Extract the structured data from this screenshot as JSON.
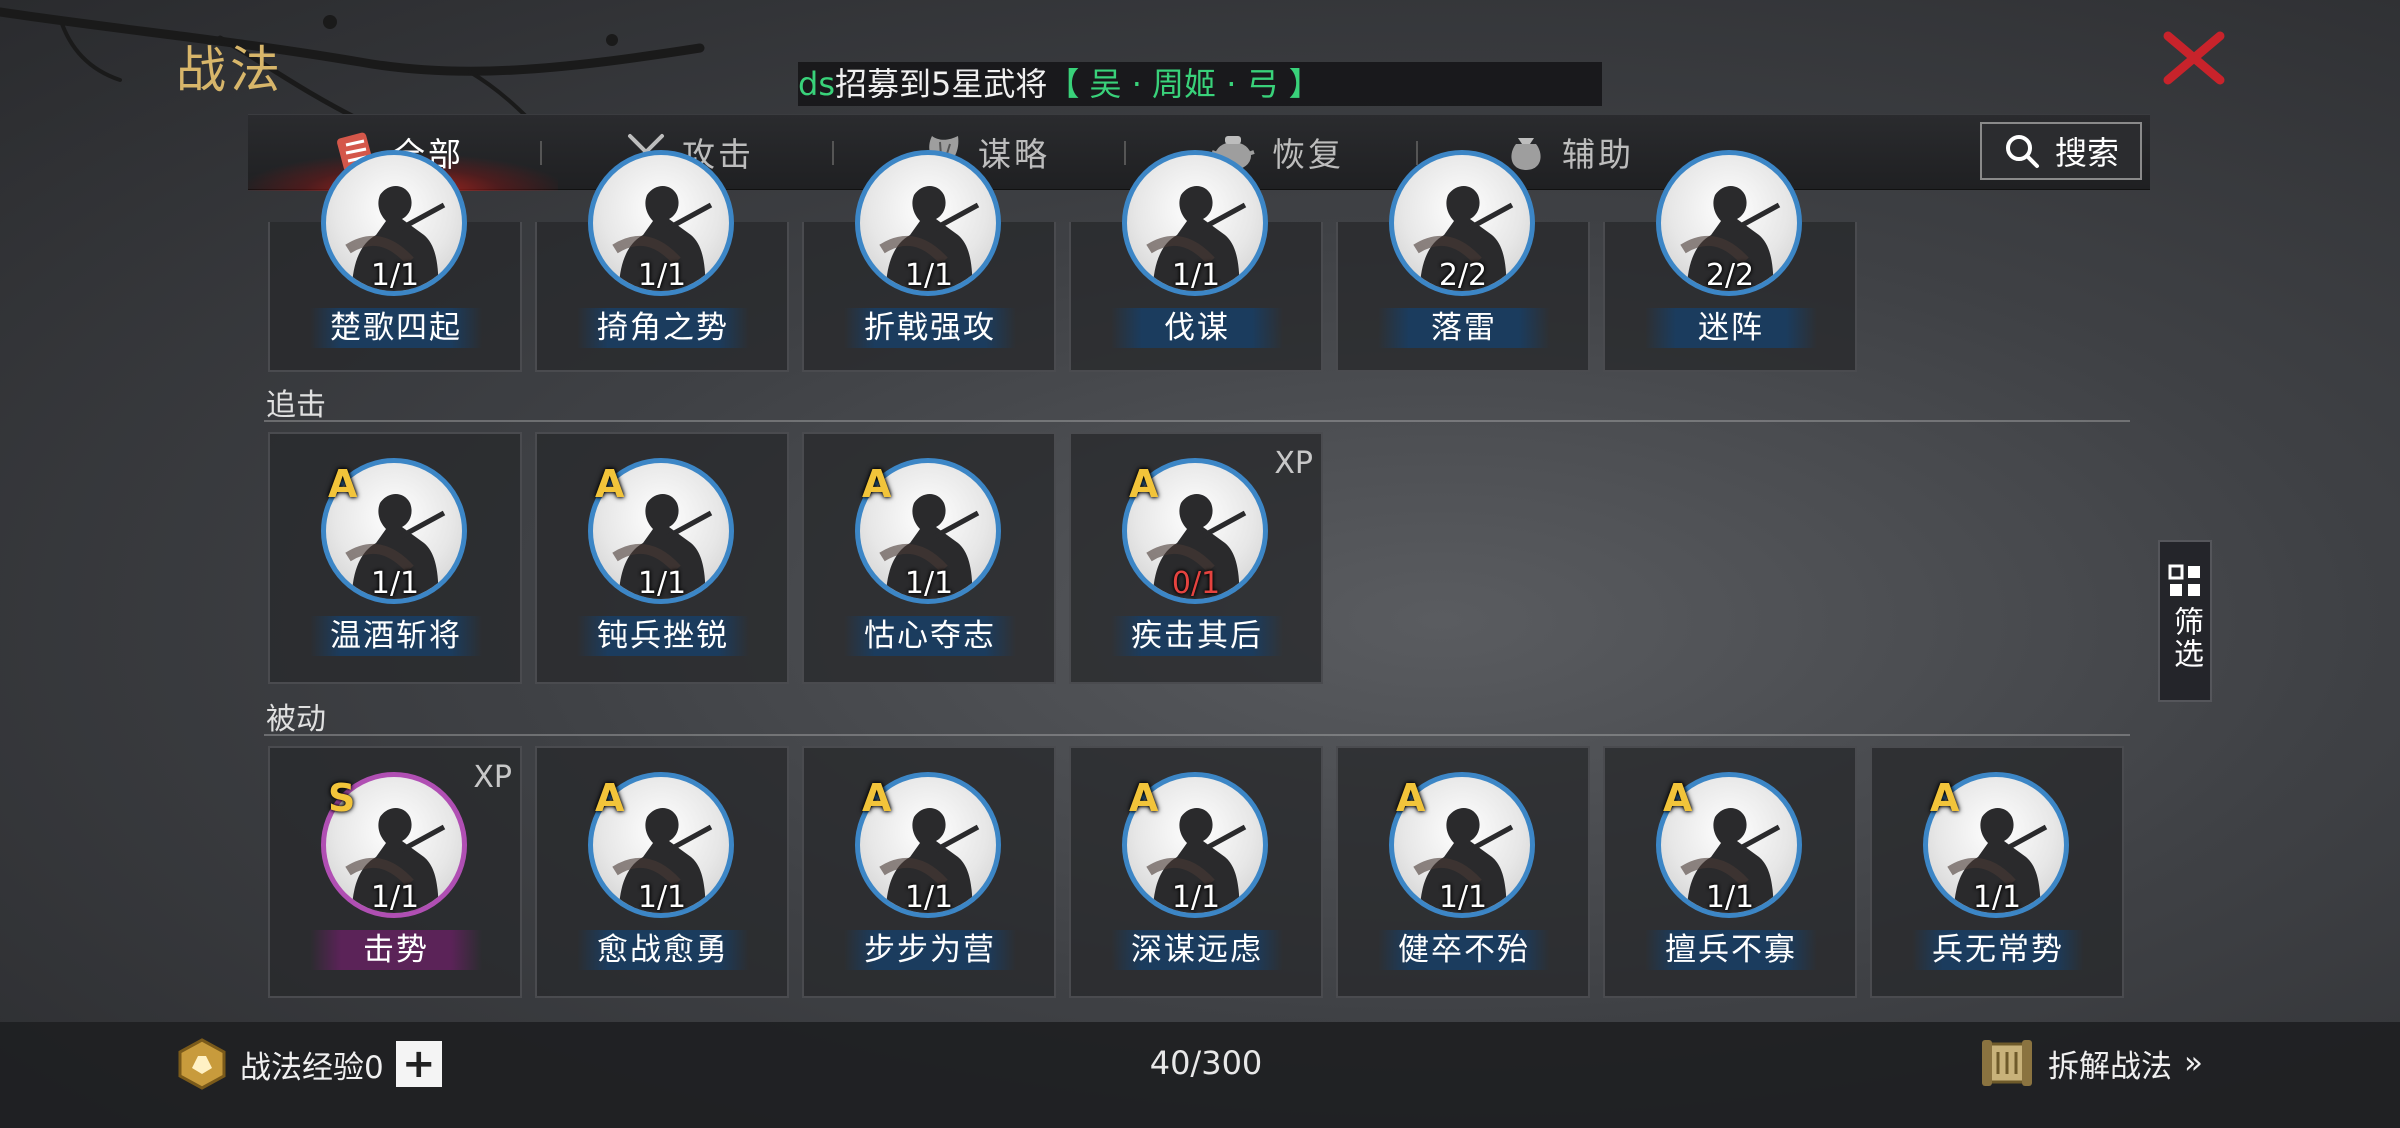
{
  "title": "战法",
  "marquee": {
    "prefix": "ds",
    "text": "招募到5星武将",
    "hero": "【 吴 · 周姬 · 弓 】"
  },
  "tabs": [
    {
      "label": "全部",
      "icon": "all-skills-icon",
      "active": true
    },
    {
      "label": "攻击",
      "icon": "crossed-swords-icon",
      "active": false
    },
    {
      "label": "谋略",
      "icon": "feather-fan-icon",
      "active": false
    },
    {
      "label": "恢复",
      "icon": "recovery-pot-icon",
      "active": false
    },
    {
      "label": "辅助",
      "icon": "pouch-icon",
      "active": false
    }
  ],
  "search": {
    "label": "搜索"
  },
  "sections": {
    "top": {
      "cards": [
        {
          "name": "楚歌四起",
          "count": "1/1"
        },
        {
          "name": "掎角之势",
          "count": "1/1"
        },
        {
          "name": "折戟强攻",
          "count": "1/1"
        },
        {
          "name": "伐谋",
          "count": "1/1"
        },
        {
          "name": "落雷",
          "count": "2/2"
        },
        {
          "name": "迷阵",
          "count": "2/2"
        }
      ]
    },
    "pursuit": {
      "label": "追击",
      "cards": [
        {
          "grade": "A",
          "name": "温酒斩将",
          "count": "1/1",
          "xp": ""
        },
        {
          "grade": "A",
          "name": "钝兵挫锐",
          "count": "1/1",
          "xp": ""
        },
        {
          "grade": "A",
          "name": "怙心夺志",
          "count": "1/1",
          "xp": ""
        },
        {
          "grade": "A",
          "name": "疾击其后",
          "count": "0/1",
          "xp": "XP"
        }
      ]
    },
    "passive": {
      "label": "被动",
      "cards": [
        {
          "grade": "S",
          "name": "击势",
          "count": "1/1",
          "xp": "XP"
        },
        {
          "grade": "A",
          "name": "愈战愈勇",
          "count": "1/1",
          "xp": ""
        },
        {
          "grade": "A",
          "name": "步步为营",
          "count": "1/1",
          "xp": ""
        },
        {
          "grade": "A",
          "name": "深谋远虑",
          "count": "1/1",
          "xp": ""
        },
        {
          "grade": "A",
          "name": "健卒不殆",
          "count": "1/1",
          "xp": ""
        },
        {
          "grade": "A",
          "name": "擅兵不寡",
          "count": "1/1",
          "xp": ""
        },
        {
          "grade": "A",
          "name": "兵无常势",
          "count": "1/1",
          "xp": ""
        }
      ]
    }
  },
  "filter": {
    "label": "筛选"
  },
  "footer": {
    "exp_label": "战法经验0",
    "plus": "+",
    "count": "40/300",
    "dismantle": "拆解战法",
    "dismantle_arrow": "»"
  },
  "colors": {
    "title_gold": "#d8b66a",
    "close_red": "#c8232b",
    "grade_gold": "#f2c43a",
    "a_ring": "#3c86c6",
    "s_ring": "#b04fb3",
    "marquee_green": "#39d27a",
    "count_red": "#e5433f"
  }
}
